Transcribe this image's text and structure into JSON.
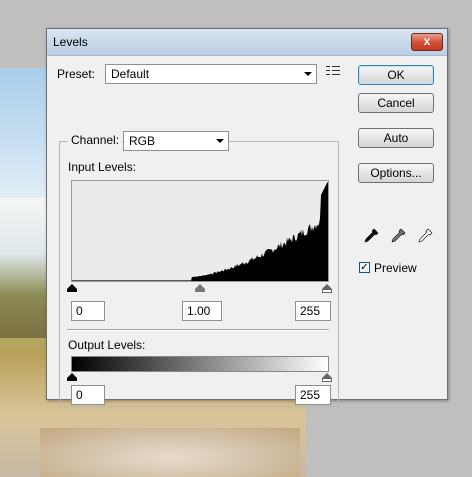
{
  "window": {
    "title": "Levels",
    "close_glyph": "x"
  },
  "preset": {
    "label": "Preset:",
    "value": "Default"
  },
  "channel": {
    "label": "Channel:",
    "value": "RGB"
  },
  "input_levels": {
    "label": "Input Levels:",
    "black": "0",
    "gamma": "1.00",
    "white": "255"
  },
  "output_levels": {
    "label": "Output Levels:",
    "black": "0",
    "white": "255"
  },
  "buttons": {
    "ok": "OK",
    "cancel": "Cancel",
    "auto": "Auto",
    "options": "Options..."
  },
  "preview": {
    "label": "Preview",
    "checked": true,
    "check_glyph": "✓"
  },
  "icons": [
    "presets-menu-icon",
    "black-eyedropper-icon",
    "gray-eyedropper-icon",
    "white-eyedropper-icon",
    "dropdown-arrow-icon"
  ]
}
